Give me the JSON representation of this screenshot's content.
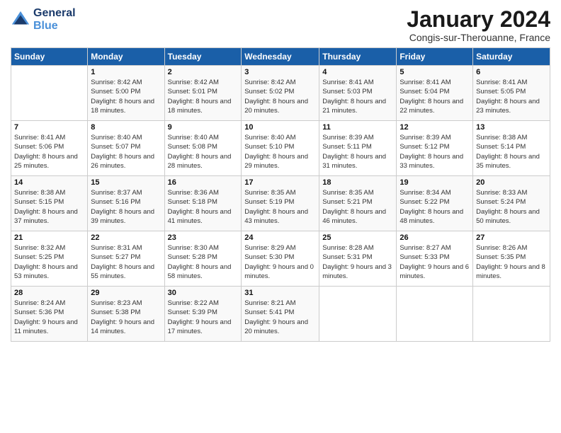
{
  "logo": {
    "line1": "General",
    "line2": "Blue"
  },
  "title": "January 2024",
  "subtitle": "Congis-sur-Therouanne, France",
  "headers": [
    "Sunday",
    "Monday",
    "Tuesday",
    "Wednesday",
    "Thursday",
    "Friday",
    "Saturday"
  ],
  "weeks": [
    [
      {
        "num": "",
        "sunrise": "",
        "sunset": "",
        "daylight": ""
      },
      {
        "num": "1",
        "sunrise": "Sunrise: 8:42 AM",
        "sunset": "Sunset: 5:00 PM",
        "daylight": "Daylight: 8 hours and 18 minutes."
      },
      {
        "num": "2",
        "sunrise": "Sunrise: 8:42 AM",
        "sunset": "Sunset: 5:01 PM",
        "daylight": "Daylight: 8 hours and 18 minutes."
      },
      {
        "num": "3",
        "sunrise": "Sunrise: 8:42 AM",
        "sunset": "Sunset: 5:02 PM",
        "daylight": "Daylight: 8 hours and 20 minutes."
      },
      {
        "num": "4",
        "sunrise": "Sunrise: 8:41 AM",
        "sunset": "Sunset: 5:03 PM",
        "daylight": "Daylight: 8 hours and 21 minutes."
      },
      {
        "num": "5",
        "sunrise": "Sunrise: 8:41 AM",
        "sunset": "Sunset: 5:04 PM",
        "daylight": "Daylight: 8 hours and 22 minutes."
      },
      {
        "num": "6",
        "sunrise": "Sunrise: 8:41 AM",
        "sunset": "Sunset: 5:05 PM",
        "daylight": "Daylight: 8 hours and 23 minutes."
      }
    ],
    [
      {
        "num": "7",
        "sunrise": "Sunrise: 8:41 AM",
        "sunset": "Sunset: 5:06 PM",
        "daylight": "Daylight: 8 hours and 25 minutes."
      },
      {
        "num": "8",
        "sunrise": "Sunrise: 8:40 AM",
        "sunset": "Sunset: 5:07 PM",
        "daylight": "Daylight: 8 hours and 26 minutes."
      },
      {
        "num": "9",
        "sunrise": "Sunrise: 8:40 AM",
        "sunset": "Sunset: 5:08 PM",
        "daylight": "Daylight: 8 hours and 28 minutes."
      },
      {
        "num": "10",
        "sunrise": "Sunrise: 8:40 AM",
        "sunset": "Sunset: 5:10 PM",
        "daylight": "Daylight: 8 hours and 29 minutes."
      },
      {
        "num": "11",
        "sunrise": "Sunrise: 8:39 AM",
        "sunset": "Sunset: 5:11 PM",
        "daylight": "Daylight: 8 hours and 31 minutes."
      },
      {
        "num": "12",
        "sunrise": "Sunrise: 8:39 AM",
        "sunset": "Sunset: 5:12 PM",
        "daylight": "Daylight: 8 hours and 33 minutes."
      },
      {
        "num": "13",
        "sunrise": "Sunrise: 8:38 AM",
        "sunset": "Sunset: 5:14 PM",
        "daylight": "Daylight: 8 hours and 35 minutes."
      }
    ],
    [
      {
        "num": "14",
        "sunrise": "Sunrise: 8:38 AM",
        "sunset": "Sunset: 5:15 PM",
        "daylight": "Daylight: 8 hours and 37 minutes."
      },
      {
        "num": "15",
        "sunrise": "Sunrise: 8:37 AM",
        "sunset": "Sunset: 5:16 PM",
        "daylight": "Daylight: 8 hours and 39 minutes."
      },
      {
        "num": "16",
        "sunrise": "Sunrise: 8:36 AM",
        "sunset": "Sunset: 5:18 PM",
        "daylight": "Daylight: 8 hours and 41 minutes."
      },
      {
        "num": "17",
        "sunrise": "Sunrise: 8:35 AM",
        "sunset": "Sunset: 5:19 PM",
        "daylight": "Daylight: 8 hours and 43 minutes."
      },
      {
        "num": "18",
        "sunrise": "Sunrise: 8:35 AM",
        "sunset": "Sunset: 5:21 PM",
        "daylight": "Daylight: 8 hours and 46 minutes."
      },
      {
        "num": "19",
        "sunrise": "Sunrise: 8:34 AM",
        "sunset": "Sunset: 5:22 PM",
        "daylight": "Daylight: 8 hours and 48 minutes."
      },
      {
        "num": "20",
        "sunrise": "Sunrise: 8:33 AM",
        "sunset": "Sunset: 5:24 PM",
        "daylight": "Daylight: 8 hours and 50 minutes."
      }
    ],
    [
      {
        "num": "21",
        "sunrise": "Sunrise: 8:32 AM",
        "sunset": "Sunset: 5:25 PM",
        "daylight": "Daylight: 8 hours and 53 minutes."
      },
      {
        "num": "22",
        "sunrise": "Sunrise: 8:31 AM",
        "sunset": "Sunset: 5:27 PM",
        "daylight": "Daylight: 8 hours and 55 minutes."
      },
      {
        "num": "23",
        "sunrise": "Sunrise: 8:30 AM",
        "sunset": "Sunset: 5:28 PM",
        "daylight": "Daylight: 8 hours and 58 minutes."
      },
      {
        "num": "24",
        "sunrise": "Sunrise: 8:29 AM",
        "sunset": "Sunset: 5:30 PM",
        "daylight": "Daylight: 9 hours and 0 minutes."
      },
      {
        "num": "25",
        "sunrise": "Sunrise: 8:28 AM",
        "sunset": "Sunset: 5:31 PM",
        "daylight": "Daylight: 9 hours and 3 minutes."
      },
      {
        "num": "26",
        "sunrise": "Sunrise: 8:27 AM",
        "sunset": "Sunset: 5:33 PM",
        "daylight": "Daylight: 9 hours and 6 minutes."
      },
      {
        "num": "27",
        "sunrise": "Sunrise: 8:26 AM",
        "sunset": "Sunset: 5:35 PM",
        "daylight": "Daylight: 9 hours and 8 minutes."
      }
    ],
    [
      {
        "num": "28",
        "sunrise": "Sunrise: 8:24 AM",
        "sunset": "Sunset: 5:36 PM",
        "daylight": "Daylight: 9 hours and 11 minutes."
      },
      {
        "num": "29",
        "sunrise": "Sunrise: 8:23 AM",
        "sunset": "Sunset: 5:38 PM",
        "daylight": "Daylight: 9 hours and 14 minutes."
      },
      {
        "num": "30",
        "sunrise": "Sunrise: 8:22 AM",
        "sunset": "Sunset: 5:39 PM",
        "daylight": "Daylight: 9 hours and 17 minutes."
      },
      {
        "num": "31",
        "sunrise": "Sunrise: 8:21 AM",
        "sunset": "Sunset: 5:41 PM",
        "daylight": "Daylight: 9 hours and 20 minutes."
      },
      {
        "num": "",
        "sunrise": "",
        "sunset": "",
        "daylight": ""
      },
      {
        "num": "",
        "sunrise": "",
        "sunset": "",
        "daylight": ""
      },
      {
        "num": "",
        "sunrise": "",
        "sunset": "",
        "daylight": ""
      }
    ]
  ]
}
